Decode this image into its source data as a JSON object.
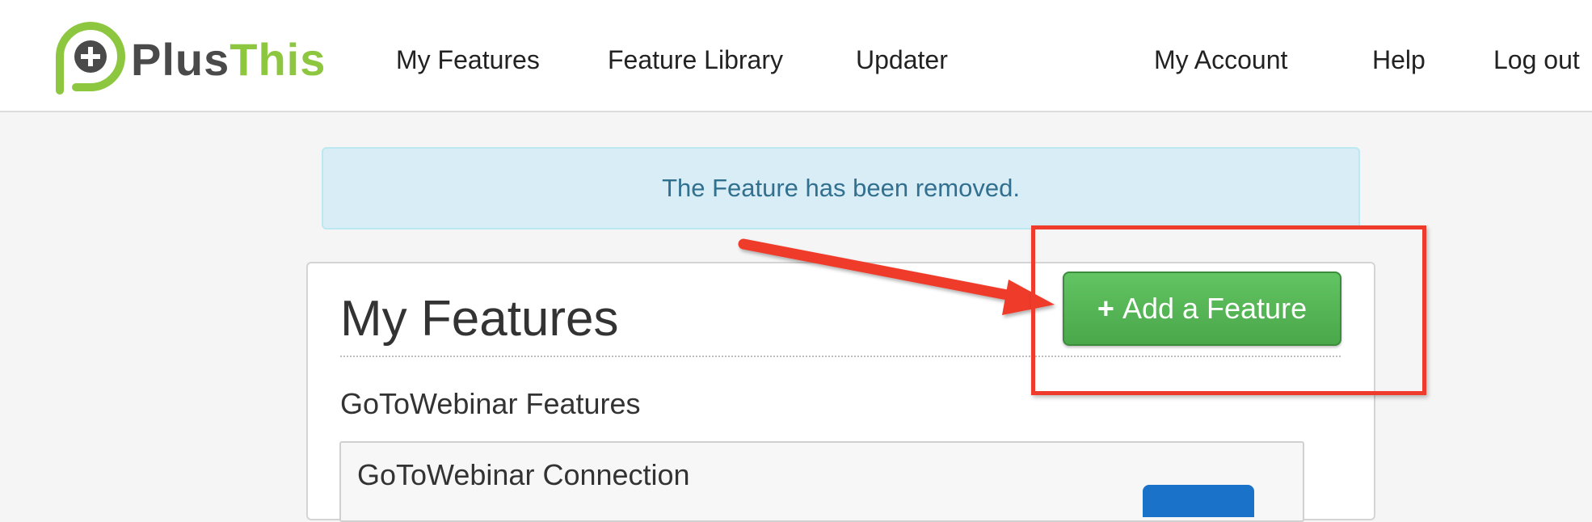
{
  "brand": {
    "name_part1": "Plus",
    "name_part2": "This",
    "color_green": "#8dc63f",
    "color_gray": "#4a4a4a"
  },
  "nav": {
    "left": [
      {
        "label": "My Features"
      },
      {
        "label": "Feature Library"
      },
      {
        "label": "Updater"
      }
    ],
    "right": [
      {
        "label": "My Account"
      },
      {
        "label": "Help"
      },
      {
        "label": "Log out"
      }
    ]
  },
  "alert": {
    "message": "The Feature has been removed.",
    "color": "#31708f",
    "background": "#d9edf7"
  },
  "main": {
    "title": "My Features",
    "add_button": {
      "icon": "plus-icon",
      "label": "Add a Feature",
      "color": "#5cb85c"
    },
    "section_heading": "GoToWebinar Features",
    "features": [
      {
        "name": "GoToWebinar Connection"
      }
    ]
  },
  "annotations": {
    "highlight_color": "#ef3b2c",
    "arrow_color": "#ef3b2c"
  }
}
